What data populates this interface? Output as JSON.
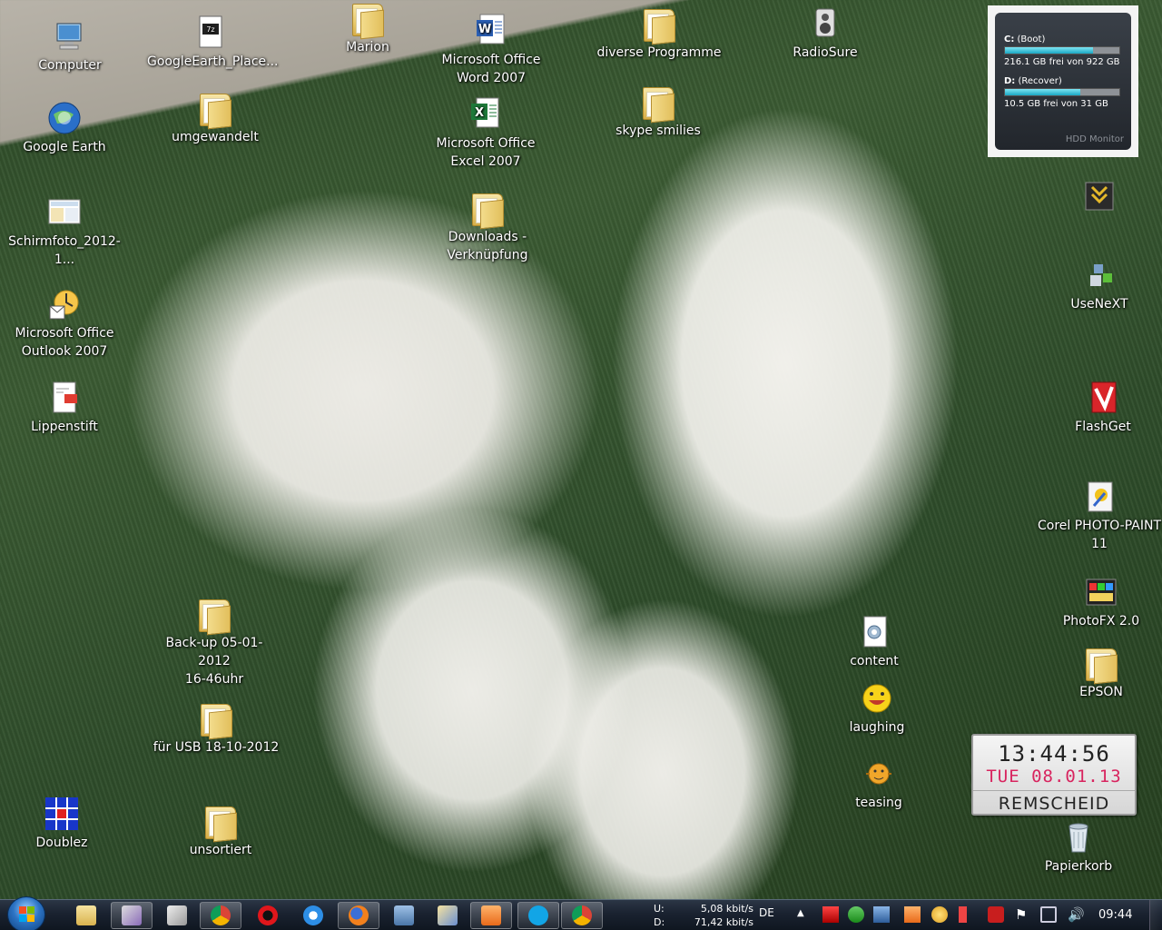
{
  "desktop": {
    "icons": {
      "computer": "Computer",
      "google_earth_place": "GoogleEarth_Place...",
      "marion": "Marion",
      "word": [
        "Microsoft Office",
        "Word 2007"
      ],
      "diverse_programme": "diverse Programme",
      "radiosure": "RadioSure",
      "google_earth": "Google Earth",
      "umgewandelt": "umgewandelt",
      "excel": [
        "Microsoft Office",
        "Excel 2007"
      ],
      "skype_smilies": "skype smilies",
      "schirmfoto": "Schirmfoto_2012-1...",
      "downloads": [
        "Downloads -",
        "Verknüpfung"
      ],
      "outlook": [
        "Microsoft Office",
        "Outlook 2007"
      ],
      "lippenstift": "Lippenstift",
      "usenext": "UseNeXT",
      "flashget": "FlashGet",
      "corel": [
        "Corel PHOTO-PAINT",
        "11"
      ],
      "photofx": "PhotoFX 2.0",
      "epson": "EPSON",
      "backup": [
        "Back-up 05-01-2012",
        "16-46uhr"
      ],
      "content": "content",
      "laughing": "laughing",
      "fuer_usb": "für USB 18-10-2012",
      "teasing": "teasing",
      "doublez": "Doublez",
      "unsortiert": "unsortiert",
      "papierkorb": "Papierkorb"
    }
  },
  "hdd_monitor": {
    "drives": [
      {
        "label": "C:",
        "name": "(Boot)",
        "free_text": "216.1 GB frei von 922 GB",
        "used_fraction": 0.77
      },
      {
        "label": "D:",
        "name": "(Recover)",
        "free_text": "10.5 GB frei von 31 GB",
        "used_fraction": 0.66
      }
    ],
    "footer": "HDD Monitor"
  },
  "clock_gadget": {
    "time": "13:44:56",
    "date": "TUE  08.01.13",
    "city": "REMSCHEID"
  },
  "taskbar": {
    "net_up_label": "U:",
    "net_up": "5,08 kbit/s",
    "net_down_label": "D:",
    "net_down": "71,42 kbit/s",
    "language": "DE",
    "time": "09:44"
  },
  "colors": {
    "grass": "#3b5b33",
    "hdd_fill": "#19a6c2",
    "clock_date": "#d8245f",
    "taskbar": "#1a2230"
  }
}
